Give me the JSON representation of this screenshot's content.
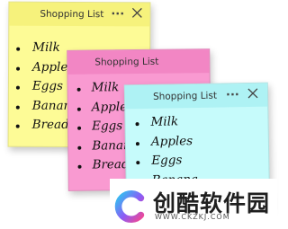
{
  "notes": {
    "yellow": {
      "title": "Shopping List",
      "menu_icon": "...",
      "close_icon": "close-icon",
      "color": "#fdfb96",
      "items": [
        "Milk",
        "Apples",
        "Eggs",
        "Banana",
        "Bread"
      ]
    },
    "pink": {
      "title": "Shopping List",
      "color": "#f99ad1",
      "items": [
        "Milk",
        "Apples",
        "Eggs",
        "Banana",
        "Bread"
      ]
    },
    "cyan": {
      "title": "Shopping List",
      "menu_icon": "...",
      "close_icon": "close-icon",
      "color": "#c6fbfb",
      "items": [
        "Milk",
        "Apples",
        "Eggs",
        "Banana"
      ]
    }
  },
  "watermark": {
    "name": "创酷软件园",
    "url": "WWW.CKZKJ.COM"
  }
}
